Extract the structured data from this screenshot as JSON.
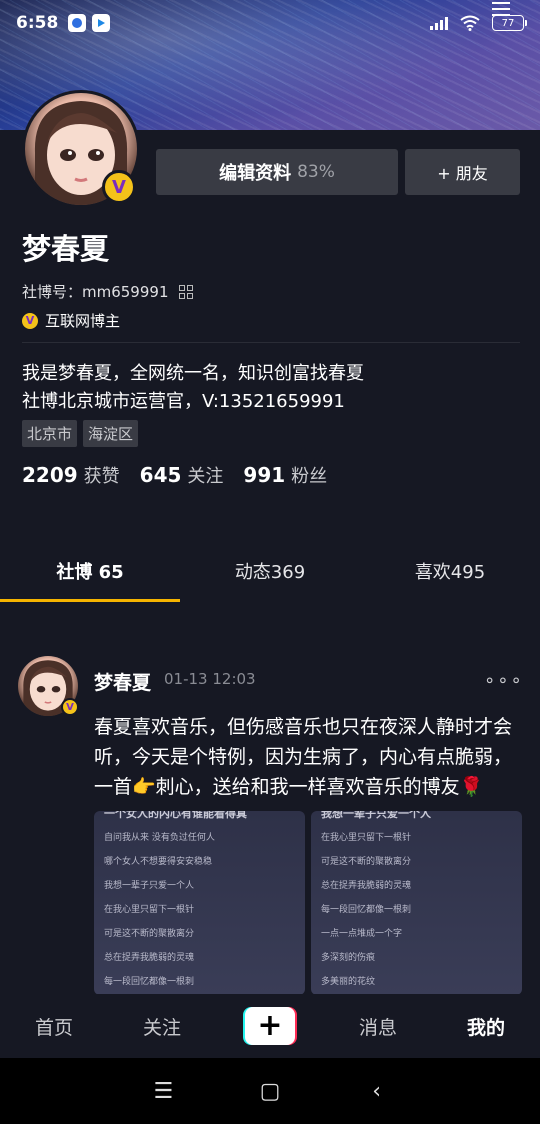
{
  "status_bar": {
    "time": "6:58",
    "battery": "77"
  },
  "profile": {
    "edit_label": "编辑资料",
    "edit_percent": "83%",
    "friend_label": "+ 朋友",
    "name": "梦春夏",
    "account_id": "社博号：mm659991",
    "verified_label": "互联网博主",
    "badge_letter": "V",
    "bio_line1": "我是梦春夏，全网统一名，知识创富找春夏",
    "bio_line2": "社博北京城市运营官，V:13521659991",
    "tags": [
      "北京市",
      "海淀区"
    ],
    "stats": [
      {
        "value": "2209",
        "label": "获赞"
      },
      {
        "value": "645",
        "label": "关注"
      },
      {
        "value": "991",
        "label": "粉丝"
      }
    ]
  },
  "tabs": [
    {
      "label": "社博 65"
    },
    {
      "label": "动态369"
    },
    {
      "label": "喜欢495"
    }
  ],
  "post": {
    "author": "梦春夏",
    "time": "01-13 12:03",
    "more": "∘∘∘",
    "text": "春夏喜欢音乐，但伤感音乐也只在夜深人静时才会听，今天是个特例，因为生病了，内心有点脆弱，一首👉刺心，送给和我一样喜欢音乐的博友🌹",
    "images": [
      {
        "head": "一个女人的内心有谁能看得真",
        "lines": [
          "自问我从来 没有负过任何人",
          "哪个女人不想要得安安稳稳",
          "我想一辈子只爱一个人",
          "在我心里只留下一根针",
          "可是这不断的聚散离分",
          "总在捉弄我脆弱的灵魂",
          "每一段回忆都像一根刺"
        ]
      },
      {
        "head": "我想一辈子只爱一个人",
        "lines": [
          "在我心里只留下一根针",
          "可是这不断的聚散离分",
          "总在捉弄我脆弱的灵魂",
          "每一段回忆都像一根刺",
          "一点一点堆成一个字",
          "多深刻的伤痕",
          "多美丽的花纹"
        ]
      }
    ]
  },
  "bottom_nav": {
    "home": "首页",
    "follow": "关注",
    "create": "+",
    "messages": "消息",
    "me": "我的"
  },
  "system_nav": {
    "menu": "☰",
    "home": "▢",
    "back": "‹"
  },
  "colors": {
    "background": "#161823",
    "accent_tab": "#f5b400",
    "badge": "#f4c21a"
  }
}
